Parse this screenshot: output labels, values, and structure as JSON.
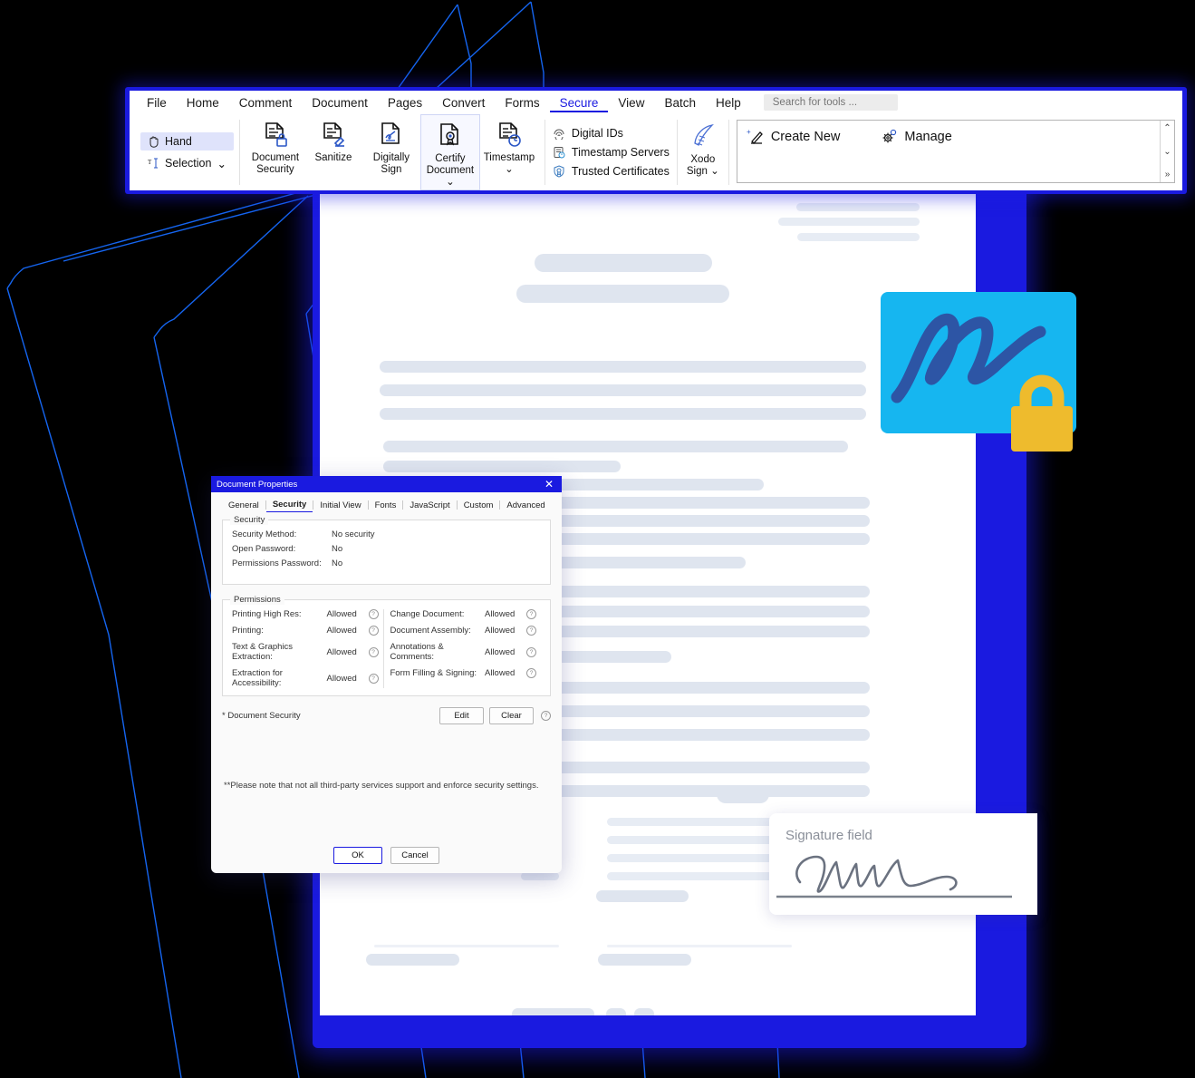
{
  "app": {
    "menu": [
      {
        "label": "File",
        "active": false
      },
      {
        "label": "Home",
        "active": false
      },
      {
        "label": "Comment",
        "active": false
      },
      {
        "label": "Document",
        "active": false
      },
      {
        "label": "Pages",
        "active": false
      },
      {
        "label": "Convert",
        "active": false
      },
      {
        "label": "Forms",
        "active": false
      },
      {
        "label": "Secure",
        "active": true
      },
      {
        "label": "View",
        "active": false
      },
      {
        "label": "Batch",
        "active": false
      },
      {
        "label": "Help",
        "active": false
      }
    ],
    "search": {
      "placeholder": "Search for tools ...",
      "value": ""
    }
  },
  "ribbon": {
    "modes": [
      {
        "label": "Hand",
        "icon": "hand-icon",
        "selected": true
      },
      {
        "label": "Selection",
        "icon": "text-select-icon",
        "selected": false,
        "caret": "⌄"
      }
    ],
    "tools": [
      {
        "line1": "Document",
        "line2": "Security",
        "icon": "document-lock-icon",
        "boxed": false
      },
      {
        "line1": "Sanitize",
        "line2": "",
        "icon": "document-eraser-icon",
        "boxed": false
      },
      {
        "line1": "Digitally",
        "line2": "Sign",
        "icon": "document-signature-icon",
        "boxed": false
      },
      {
        "line1": "Certify",
        "line2": "Document ⌄",
        "icon": "document-badge-icon",
        "boxed": true
      },
      {
        "line1": "Timestamp",
        "line2": "⌄",
        "icon": "document-clock-icon",
        "boxed": false
      }
    ],
    "small_items": [
      {
        "label": "Digital IDs",
        "icon": "fingerprint-icon"
      },
      {
        "label": "Timestamp Servers",
        "icon": "server-clock-icon"
      },
      {
        "label": "Trusted Certificates",
        "icon": "shield-certificate-icon"
      }
    ],
    "xodo_sign": {
      "line1": "Xodo",
      "line2": "Sign ⌄",
      "icon": "quill-icon"
    },
    "gallery": [
      {
        "label": "Create New",
        "icon": "create-new-signature-icon"
      },
      {
        "label": "Manage",
        "icon": "gear-icon"
      }
    ],
    "scroller": {
      "up": "⌃",
      "down": "⌄",
      "more": "»"
    }
  },
  "dialog": {
    "title": "Document Properties",
    "close_icon": "close-icon",
    "tabs": [
      {
        "label": "General",
        "selected": false
      },
      {
        "label": "Security",
        "selected": true
      },
      {
        "label": "Initial View",
        "selected": false
      },
      {
        "label": "Fonts",
        "selected": false
      },
      {
        "label": "JavaScript",
        "selected": false
      },
      {
        "label": "Custom",
        "selected": false
      },
      {
        "label": "Advanced",
        "selected": false
      }
    ],
    "security": {
      "legend": "Security",
      "rows": [
        {
          "key": "Security Method:",
          "value": "No security"
        },
        {
          "key": "Open Password:",
          "value": "No"
        },
        {
          "key": "Permissions Password:",
          "value": "No"
        }
      ]
    },
    "permissions": {
      "legend": "Permissions",
      "left": [
        {
          "key": "Printing High Res:",
          "value": "Allowed"
        },
        {
          "key": "Printing:",
          "value": "Allowed"
        },
        {
          "key": "Text & Graphics Extraction:",
          "value": "Allowed"
        },
        {
          "key": "Extraction for Accessibility:",
          "value": "Allowed"
        }
      ],
      "right": [
        {
          "key": "Change Document:",
          "value": "Allowed"
        },
        {
          "key": "Document Assembly:",
          "value": "Allowed"
        },
        {
          "key": "Annotations & Comments:",
          "value": "Allowed"
        },
        {
          "key": "Form Filling & Signing:",
          "value": "Allowed"
        }
      ],
      "help_glyph": "?"
    },
    "document_security": {
      "label": "* Document Security",
      "edit_label": "Edit",
      "clear_label": "Clear"
    },
    "note": "**Please note that not all third-party services support and enforce security settings.",
    "ok_label": "OK",
    "cancel_label": "Cancel"
  },
  "signature_card": {
    "title": "Signature field",
    "signature_icon": "handwritten-signature-icon"
  },
  "badge": {
    "signature_icon": "signature-squiggle-icon",
    "lock_icon": "padlock-icon"
  },
  "colors": {
    "brand_blue": "#1a1ae0",
    "cyan": "#16b6f0",
    "signature_navy": "#2d55a5",
    "lock_yellow": "#eebb2d",
    "skeleton": "#dfe5ef",
    "page_white": "#ffffff"
  }
}
